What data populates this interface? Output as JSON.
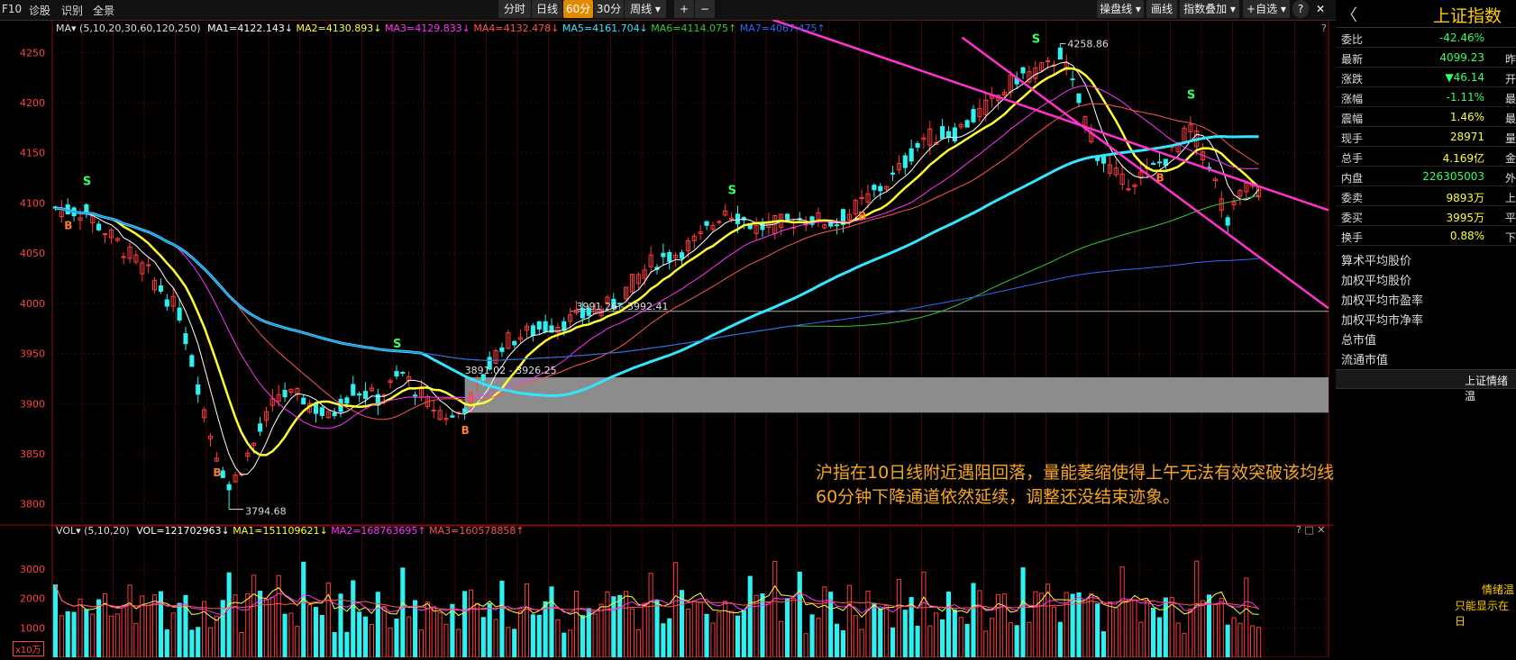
{
  "colors": {
    "up": "#ff3b3b",
    "down": "#2ef0f0",
    "ma1": "#ffffff",
    "ma2": "#ffff33",
    "ma3": "#ff33ff",
    "ma4": "#ff5555",
    "ma5": "#33e6ff",
    "ma6": "#33cc33",
    "ma7": "#3366ff",
    "channel": "#ff33cc",
    "accent": "#e08a00"
  },
  "topbar": {
    "left_items": [
      "F10",
      "诊股",
      "识别",
      "全景"
    ],
    "period_tabs": [
      "分时",
      "日线",
      "60分",
      "30分",
      "周线 ▾"
    ],
    "active_period": "60分",
    "zoom_in": "+",
    "zoom_out": "−",
    "right_items": [
      "操盘线 ▾",
      "画线",
      "指数叠加 ▾",
      "+自选 ▾",
      "?"
    ],
    "close_label": "✕"
  },
  "ma_legend": {
    "prefix": "MA▾",
    "params": "(5,10,20,30,60,120,250)",
    "items": [
      {
        "label": "MA1=4122.143↓",
        "color": "#ffffff"
      },
      {
        "label": "MA2=4130.893↓",
        "color": "#ffff33"
      },
      {
        "label": "MA3=4129.833↓",
        "color": "#ff33ff"
      },
      {
        "label": "MA4=4132.478↓",
        "color": "#ff5555"
      },
      {
        "label": "MA5=4161.704↓",
        "color": "#33e6ff"
      },
      {
        "label": "MA6=4114.075↑",
        "color": "#33cc33"
      },
      {
        "label": "MA7=4067.475↑",
        "color": "#3366ff"
      }
    ]
  },
  "vol_legend": {
    "prefix": "VOL▾",
    "params": "(5,10,20)",
    "items": [
      {
        "label": "VOL=121702963↓",
        "color": "#ffffff"
      },
      {
        "label": "MA1=151109621↓",
        "color": "#ffff33"
      },
      {
        "label": "MA2=168763695↑",
        "color": "#ff33ff"
      },
      {
        "label": "MA3=160578858↑",
        "color": "#ff5555"
      }
    ],
    "unit": "x10万",
    "panel_icons": "? □ ✕"
  },
  "chart_data": {
    "type": "candlestick",
    "price_axis_ticks": [
      4250,
      4200,
      4150,
      4100,
      4050,
      4000,
      3950,
      3900,
      3850,
      3800
    ],
    "price_range": [
      3780,
      4270
    ],
    "volume_axis_ticks": [
      3000,
      2000,
      1000
    ],
    "volume_range": [
      0,
      3800
    ],
    "annotations": {
      "high": "4258.86",
      "low": "3794.68",
      "range1": "3991.26 - 3992.41",
      "range2": "3891.02 - 3926.25"
    },
    "gap_zone": {
      "low": 3891.02,
      "high": 3926.25
    },
    "level_line": 3992.0,
    "signals": [
      {
        "label": "B",
        "bar": 2,
        "kind": "buy"
      },
      {
        "label": "S",
        "bar": 5,
        "kind": "sell"
      },
      {
        "label": "B",
        "bar": 26,
        "kind": "buy"
      },
      {
        "label": "S",
        "bar": 55,
        "kind": "sell"
      },
      {
        "label": "B",
        "bar": 66,
        "kind": "buy"
      },
      {
        "label": "S",
        "bar": 109,
        "kind": "sell"
      },
      {
        "label": "B",
        "bar": 130,
        "kind": "buy"
      },
      {
        "label": "S",
        "bar": 158,
        "kind": "sell"
      },
      {
        "label": "B",
        "bar": 178,
        "kind": "buy"
      },
      {
        "label": "S",
        "bar": 183,
        "kind": "sell"
      }
    ],
    "description_note": "Shanghai Composite 60-minute K-line with moving averages and descending channel"
  },
  "annotation_text": [
    "沪指在10日线附近遇阻回落，量能萎缩使得上午无法有效突破该均线，",
    "60分钟下降通道依然延续，调整还没结束迹象。"
  ],
  "right_panel": {
    "title": "上证指数",
    "back": "〈",
    "rows": [
      {
        "label": "委比",
        "value": "-42.46%",
        "color": "#33ff66",
        "tail": ""
      },
      {
        "label": "最新",
        "value": "4099.23",
        "color": "#33ff66",
        "tail": "昨"
      },
      {
        "label": "涨跌",
        "value": "▼46.14",
        "color": "#33ff66",
        "tail": "开"
      },
      {
        "label": "涨幅",
        "value": "-1.11%",
        "color": "#33ff66",
        "tail": "最"
      },
      {
        "label": "震幅",
        "value": "1.46%",
        "color": "#ffff33",
        "tail": "最"
      },
      {
        "label": "现手",
        "value": "28971",
        "color": "#ffff33",
        "tail": "量"
      },
      {
        "label": "总手",
        "value": "4.169亿",
        "color": "#ffff33",
        "tail": "金"
      },
      {
        "label": "内盘",
        "value": "226305003",
        "color": "#33ff66",
        "tail": "外"
      },
      {
        "label": "委卖",
        "value": "9893万",
        "color": "#ffff33",
        "tail": "上"
      },
      {
        "label": "委买",
        "value": "3995万",
        "color": "#ffff33",
        "tail": "平"
      },
      {
        "label": "换手",
        "value": "0.88%",
        "color": "#ffff33",
        "tail": "下"
      }
    ],
    "stats": [
      "算术平均股价",
      "加权平均股价",
      "加权平均市盈率",
      "加权平均市净率",
      "总市值",
      "流通市值"
    ],
    "sentiment_title": "上证情绪温",
    "sentiment_note1": "情绪温",
    "sentiment_note2": "只能显示在日"
  }
}
